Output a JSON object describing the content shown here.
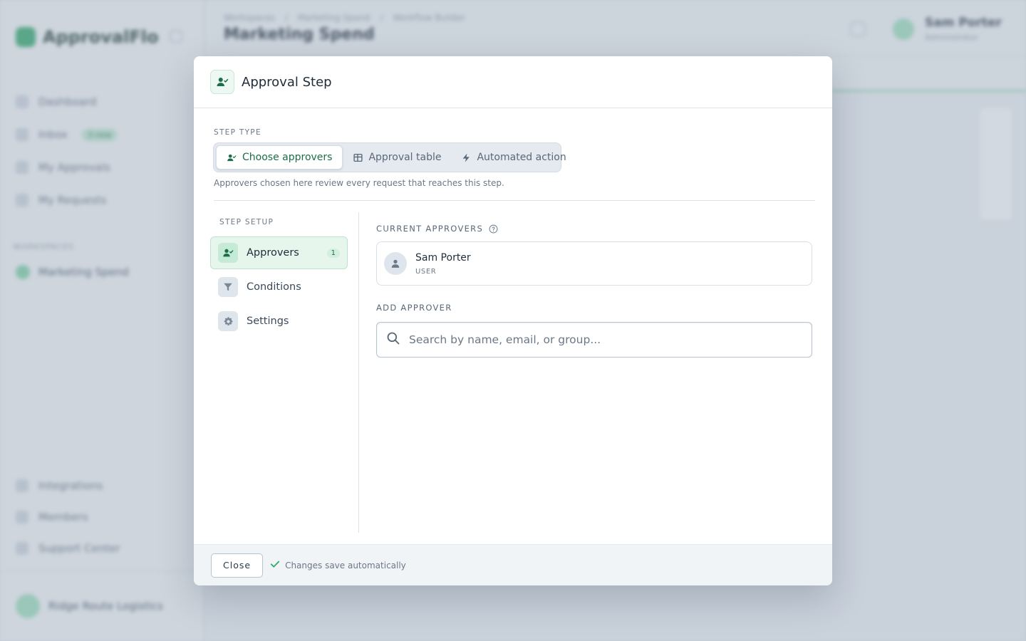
{
  "background": {
    "app_name": "ApprovalFlo",
    "nav": [
      {
        "label": "Dashboard"
      },
      {
        "label": "Inbox",
        "badge": "3 new"
      },
      {
        "label": "My Approvals"
      },
      {
        "label": "My Requests"
      }
    ],
    "section_label": "WORKSPACES",
    "workspace": "Marketing Spend",
    "bottom_nav": [
      {
        "label": "Integrations"
      },
      {
        "label": "Members"
      },
      {
        "label": "Support Center"
      }
    ],
    "user_footer": "Ridge Route Logistics",
    "breadcrumbs": [
      "Workspaces",
      "Marketing Spend",
      "Workflow Builder"
    ],
    "page_title": "Marketing Spend",
    "header_user_name": "Sam Porter",
    "header_user_sub": "Administrator"
  },
  "modal": {
    "title": "Approval Step",
    "step_type_label": "STEP TYPE",
    "step_types": [
      {
        "label": "Choose approvers",
        "icon": "user-check-icon",
        "active": true
      },
      {
        "label": "Approval table",
        "icon": "table-icon",
        "active": false
      },
      {
        "label": "Automated action",
        "icon": "lightning-icon",
        "active": false
      }
    ],
    "step_hint": "Approvers chosen here review every request that reaches this step.",
    "setup_label": "STEP SETUP",
    "setup_items": [
      {
        "label": "Approvers",
        "icon": "user-check-icon",
        "count": "1",
        "active": true
      },
      {
        "label": "Conditions",
        "icon": "filter-icon"
      },
      {
        "label": "Settings",
        "icon": "gear-icon"
      }
    ],
    "current_approvers_label": "CURRENT APPROVERS",
    "approvers": [
      {
        "name": "Sam Porter",
        "role": "USER"
      }
    ],
    "add_approver_label": "ADD APPROVER",
    "search": {
      "value": "",
      "placeholder": "Search by name, email, or group..."
    },
    "footer": {
      "close_label": "Close",
      "saved_text": "Changes save automatically"
    }
  },
  "colors": {
    "accent": "#1b6e48",
    "accent_light": "#e6f6ed",
    "success_check": "#2fa86a"
  }
}
